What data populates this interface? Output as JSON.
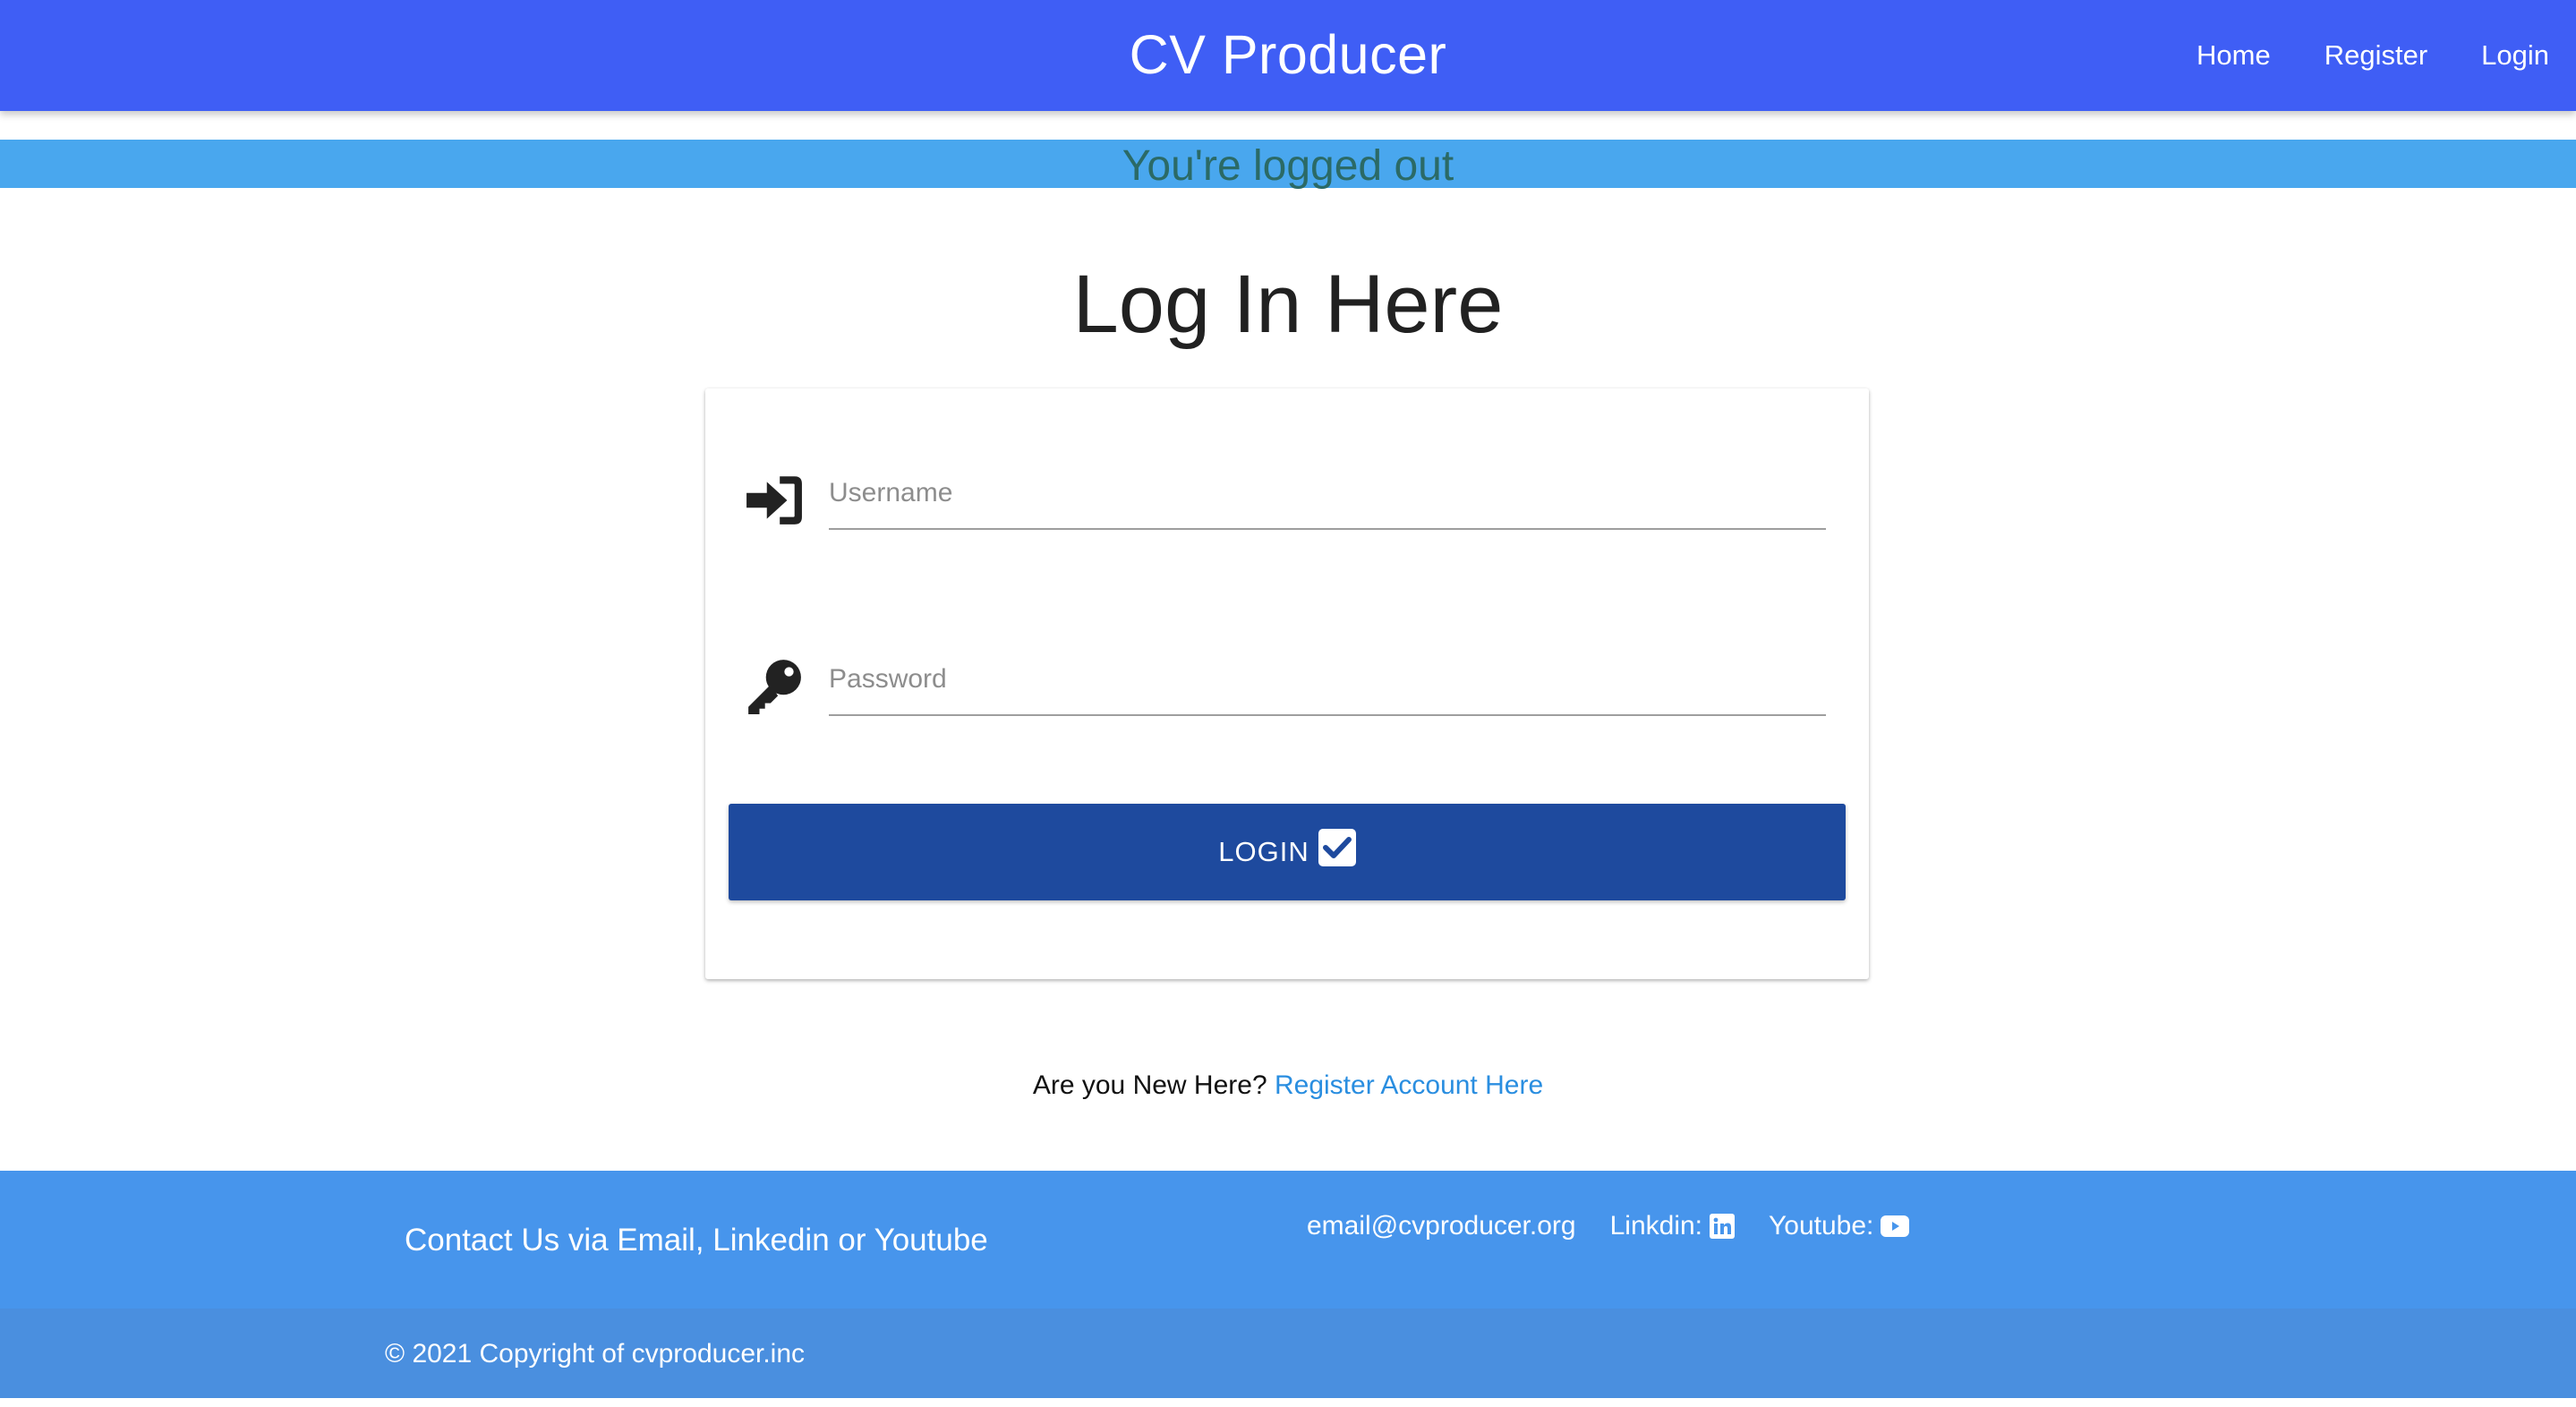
{
  "navbar": {
    "brand": "CV Producer",
    "links": [
      "Home",
      "Register",
      "Login"
    ]
  },
  "alert": {
    "message": "You're logged out"
  },
  "page": {
    "title": "Log In Here"
  },
  "form": {
    "username_placeholder": "Username",
    "password_placeholder": "Password",
    "username_value": "",
    "password_value": "",
    "login_label": "LOGIN"
  },
  "register": {
    "prompt": "Are you New Here?",
    "link_label": "Register Account Here"
  },
  "footer": {
    "contact_text": "Contact Us via Email, Linkedin or Youtube",
    "email": "email@cvproducer.org",
    "linkedin_label": "Linkdin:",
    "youtube_label": "Youtube:",
    "copyright": "© 2021 Copyright of cvproducer.inc"
  },
  "colors": {
    "navbar": "#3f5ef5",
    "alert": "#49a7ee",
    "alert_text": "#2b6a66",
    "button": "#1e4a9e",
    "link": "#2a8ee0",
    "footer_top": "#4795ec",
    "footer_bottom": "#4a8fdf"
  },
  "icons": {
    "username": "sign-in-icon",
    "password": "key-icon",
    "login": "check-square-icon",
    "linkedin": "linkedin-icon",
    "youtube": "youtube-icon"
  }
}
